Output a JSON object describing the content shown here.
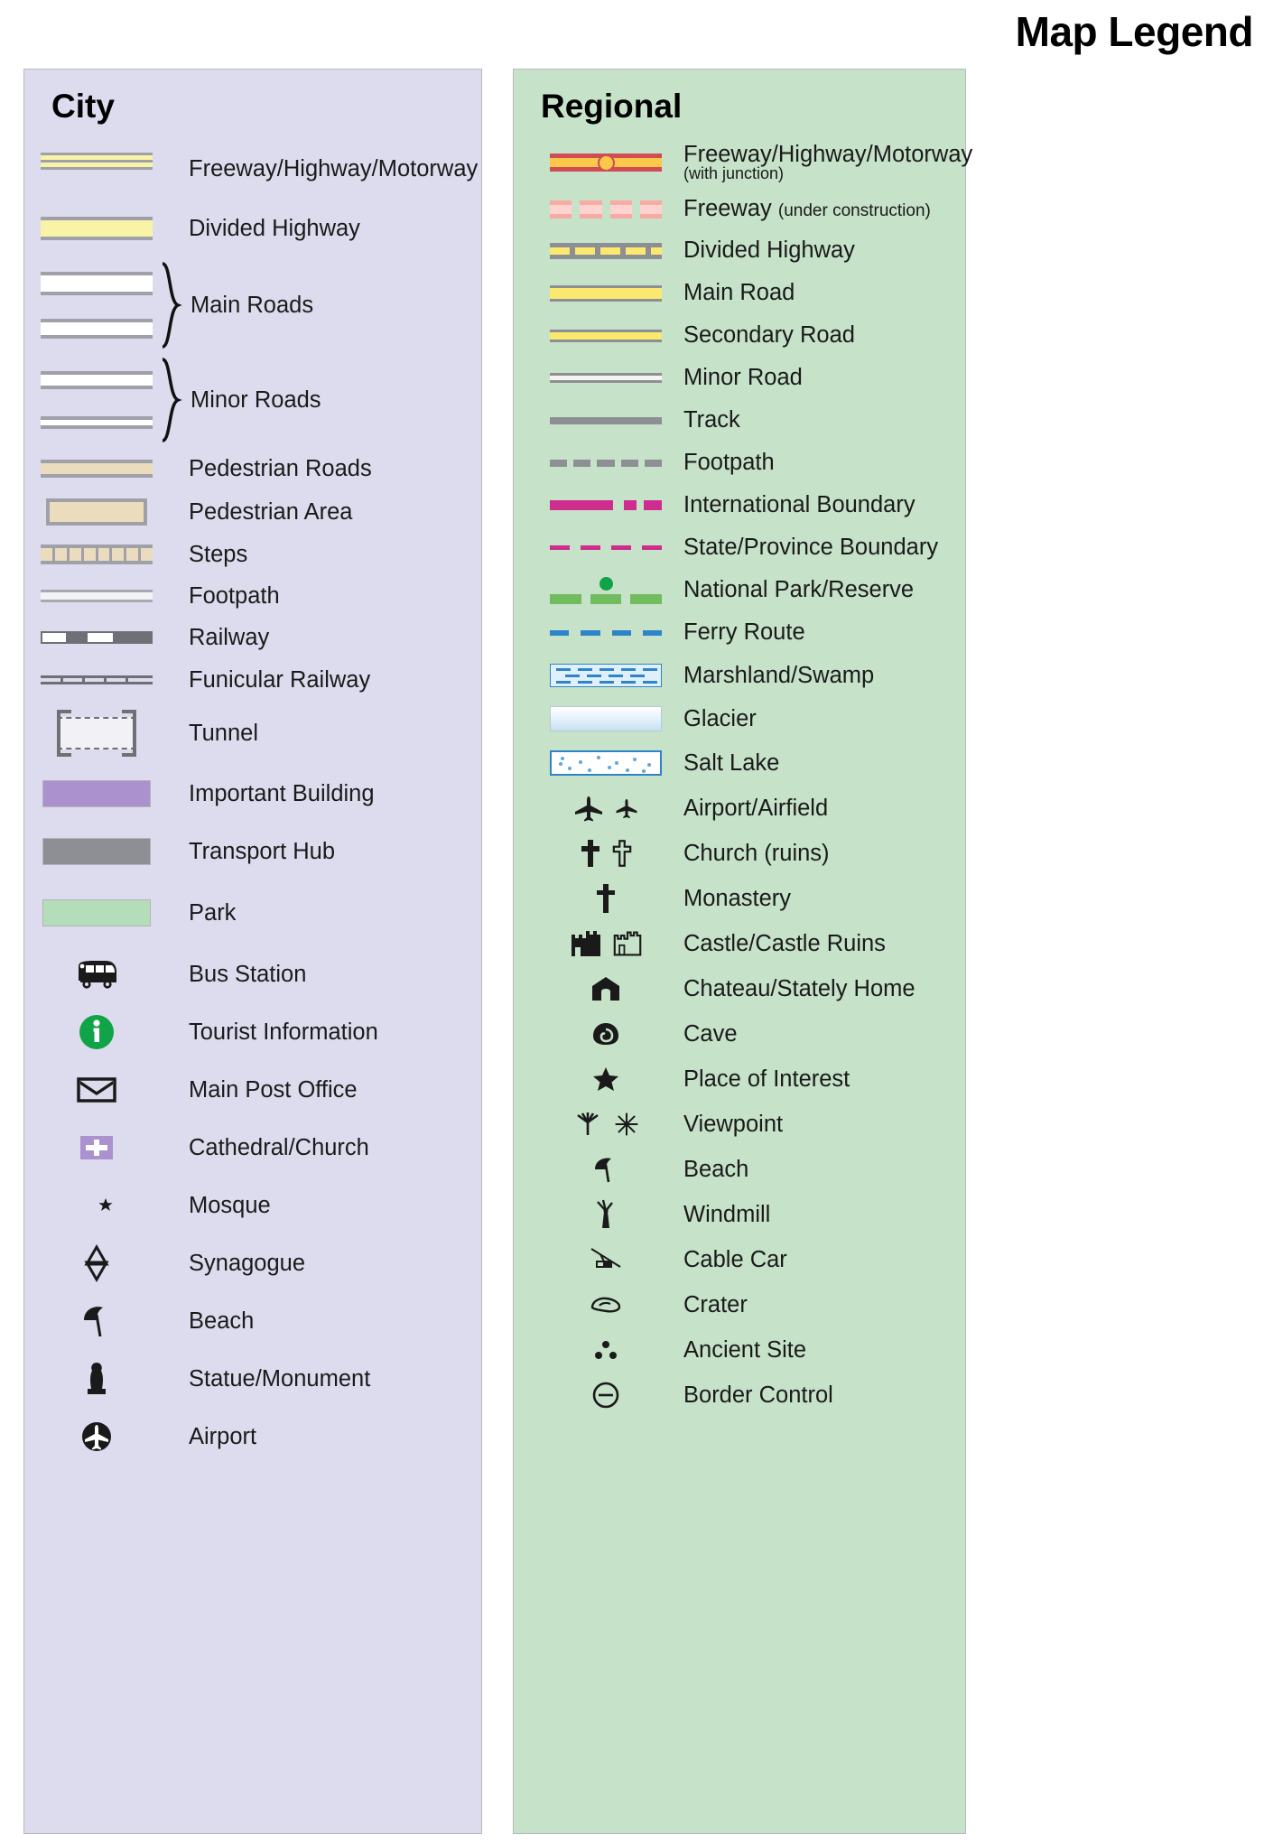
{
  "title": "Map Legend",
  "city": {
    "heading": "City",
    "items": [
      {
        "label": "Freeway/Highway/Motorway",
        "symbol": "dual-yellow-casing"
      },
      {
        "label": "Divided Highway",
        "symbol": "single-yellow-casing"
      },
      {
        "label": "Main Roads",
        "symbol": "two-white-casing-braced",
        "grouped": 2
      },
      {
        "label": "Minor Roads",
        "symbol": "two-white-thin-casing-braced",
        "grouped": 2
      },
      {
        "label": "Pedestrian Roads",
        "symbol": "tan-casing-line"
      },
      {
        "label": "Pedestrian Area",
        "symbol": "tan-filled-box"
      },
      {
        "label": "Steps",
        "symbol": "steps-hatched-bar"
      },
      {
        "label": "Footpath",
        "symbol": "thin-white-casing-line"
      },
      {
        "label": "Railway",
        "symbol": "dashed-grey-white-bar"
      },
      {
        "label": "Funicular Railway",
        "symbol": "double-line-with-ticks"
      },
      {
        "label": "Tunnel",
        "symbol": "bracketed-dashed-box"
      },
      {
        "label": "Important Building",
        "symbol": "purple-swatch"
      },
      {
        "label": "Transport Hub",
        "symbol": "grey-swatch"
      },
      {
        "label": "Park",
        "symbol": "green-swatch"
      },
      {
        "label": "Bus Station",
        "symbol": "bus-icon"
      },
      {
        "label": "Tourist Information",
        "symbol": "information-circle-icon"
      },
      {
        "label": "Main Post Office",
        "symbol": "envelope-icon"
      },
      {
        "label": "Cathedral/Church",
        "symbol": "church-cross-badge-icon"
      },
      {
        "label": "Mosque",
        "symbol": "crescent-star-icon"
      },
      {
        "label": "Synagogue",
        "symbol": "star-of-david-icon"
      },
      {
        "label": "Beach",
        "symbol": "beach-umbrella-icon"
      },
      {
        "label": "Statue/Monument",
        "symbol": "statue-icon"
      },
      {
        "label": "Airport",
        "symbol": "airplane-circle-icon"
      }
    ]
  },
  "regional": {
    "heading": "Regional",
    "items": [
      {
        "label": "Freeway/Highway/Motorway",
        "sub": "(with junction)",
        "symbol": "red-yellow-freeway-with-junction"
      },
      {
        "label": "Freeway",
        "inline_sub": "(under construction)",
        "symbol": "pink-dashed-freeway"
      },
      {
        "label": "Divided Highway",
        "symbol": "grey-yellow-dashed-divided"
      },
      {
        "label": "Main Road",
        "symbol": "yellow-casing-thick"
      },
      {
        "label": "Secondary Road",
        "symbol": "yellow-casing-thin"
      },
      {
        "label": "Minor Road",
        "symbol": "white-casing-thin"
      },
      {
        "label": "Track",
        "symbol": "solid-grey-line"
      },
      {
        "label": "Footpath",
        "symbol": "grey-dashed-line"
      },
      {
        "label": "International Boundary",
        "symbol": "magenta-dash-dot-line"
      },
      {
        "label": "State/Province Boundary",
        "symbol": "magenta-thin-dashed-line"
      },
      {
        "label": "National Park/Reserve",
        "symbol": "green-dash-with-dot"
      },
      {
        "label": "Ferry Route",
        "symbol": "blue-dashed-line"
      },
      {
        "label": "Marshland/Swamp",
        "symbol": "marsh-hatch-box"
      },
      {
        "label": "Glacier",
        "symbol": "glacier-gradient-box"
      },
      {
        "label": "Salt Lake",
        "symbol": "salt-lake-dotted-box"
      },
      {
        "label": "Airport/Airfield",
        "symbol": "airplane-pair-icon"
      },
      {
        "label": "Church (ruins)",
        "symbol": "cross-pair-icon"
      },
      {
        "label": "Monastery",
        "symbol": "latin-cross-icon"
      },
      {
        "label": "Castle/Castle Ruins",
        "symbol": "castle-pair-icon"
      },
      {
        "label": "Chateau/Stately Home",
        "symbol": "chateau-icon"
      },
      {
        "label": "Cave",
        "symbol": "cave-icon"
      },
      {
        "label": "Place of Interest",
        "symbol": "star-icon"
      },
      {
        "label": "Viewpoint",
        "symbol": "viewpoint-pair-icon"
      },
      {
        "label": "Beach",
        "symbol": "beach-umbrella-icon"
      },
      {
        "label": "Windmill",
        "symbol": "windmill-icon"
      },
      {
        "label": "Cable Car",
        "symbol": "cable-car-icon"
      },
      {
        "label": "Crater",
        "symbol": "crater-icon"
      },
      {
        "label": "Ancient Site",
        "symbol": "ancient-site-dots-icon"
      },
      {
        "label": "Border Control",
        "symbol": "border-control-circle-icon"
      }
    ]
  },
  "colors": {
    "city_panel_bg": "#dddcee",
    "regional_panel_bg": "#c6e2c9",
    "freeway_yellow": "#f8f3a7",
    "pedestrian_tan": "#ecdcbe",
    "important_building": "#ab91ce",
    "transport_hub": "#8e8f95",
    "park_green": "#b6ddb9",
    "tourist_info_green": "#10a348",
    "regional_freeway_red": "#cf4d53",
    "regional_freeway_yellow": "#fbc84a",
    "regional_road_yellow": "#fbe96f",
    "boundary_magenta": "#cf2d8e",
    "national_park_green": "#73bb60",
    "ferry_blue": "#2f84c9",
    "casing_grey": "#a0a1a8"
  }
}
